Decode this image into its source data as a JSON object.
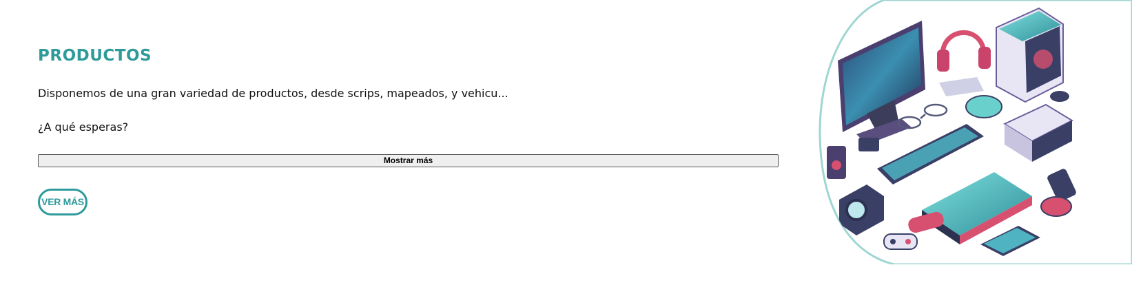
{
  "section": {
    "title": "PRODUCTOS",
    "description": "Disponemos de una gran variedad de productos, desde scrips, mapeados, y vehicu...",
    "question": "¿A qué esperas?",
    "toggle_label": "Mostrar más",
    "cta_label": "VER MÁS"
  },
  "theme": {
    "accent": "#2e9a9a",
    "text": "#111111"
  },
  "hero_image": {
    "icons": [
      "monitor-icon",
      "headphones-icon",
      "pc-tower-icon",
      "glasses-icon",
      "mouse-icon",
      "keyboard-icon",
      "router-icon",
      "speaker-icon",
      "camera-icon",
      "laptop-icon",
      "tablet-icon",
      "gamepad-icon",
      "phone-icon"
    ]
  }
}
